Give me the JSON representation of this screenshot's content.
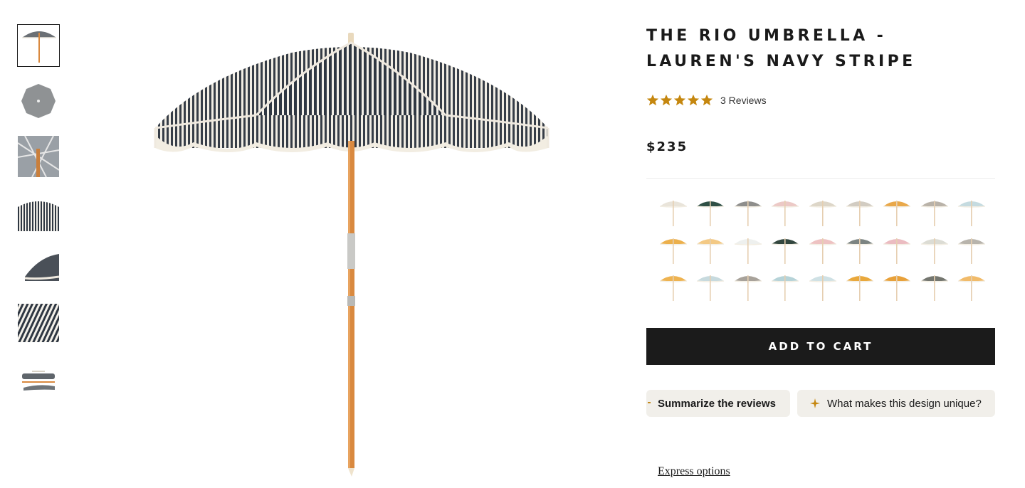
{
  "product": {
    "title_line1": "THE RIO UMBRELLA -",
    "title_line2": "LAUREN'S NAVY STRIPE",
    "rating": 5,
    "reviews_label": "3 Reviews",
    "price": "$235"
  },
  "gallery": {
    "thumbnails": [
      "umbrella-side-view",
      "umbrella-top-view",
      "canopy-underside",
      "canopy-closeup",
      "canopy-edge-detail",
      "stripe-fabric-detail",
      "carry-bag"
    ],
    "active_index": 0
  },
  "variants": {
    "colors": [
      "#e9e4da",
      "#2e4f45",
      "#8e8e8c",
      "#ecc9c6",
      "#ddd6c8",
      "#d2ccc2",
      "#e9a84a",
      "#b9b2a8",
      "#c5dbe0",
      "#ecb04c",
      "#f3c984",
      "#eef0ee",
      "#33473f",
      "#eec2c2",
      "#7c8482",
      "#ebbcc1",
      "#dcdcd4",
      "#b8b4ac",
      "#eeb351",
      "#c7dade",
      "#a8a29a",
      "#b6d3d8",
      "#cfe1e5",
      "#e9a83c",
      "#e8a13a",
      "#74766f",
      "#f1bb6a"
    ]
  },
  "actions": {
    "add_to_cart": "ADD TO CART",
    "express": "Express options"
  },
  "ai_chips": {
    "summarize": "Summarize the reviews",
    "unique": "What makes this design unique?"
  },
  "colors": {
    "star": "#c5870f",
    "button_bg": "#1b1b1b",
    "chip_bg": "#f1efea",
    "pole": "#d9893f",
    "stripe_dark": "#2f3742",
    "trim": "#f2ede2"
  }
}
